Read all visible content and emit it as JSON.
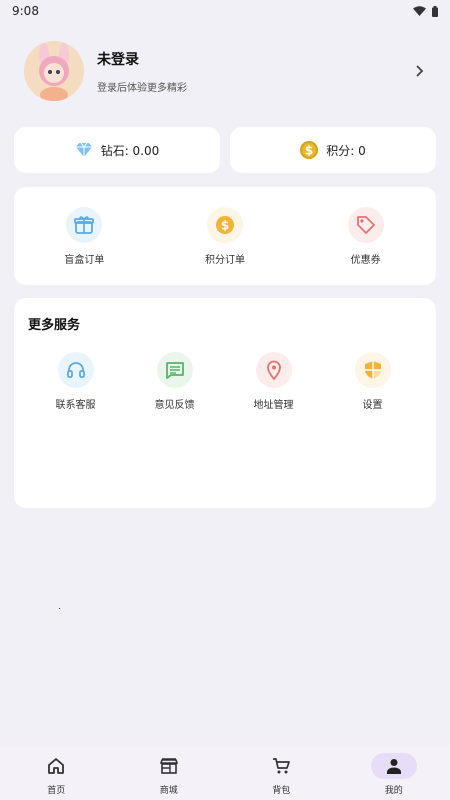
{
  "status_bar": {
    "time": "9:08"
  },
  "profile": {
    "name": "未登录",
    "subtitle": "登录后体验更多精彩"
  },
  "balances": {
    "diamond_label": "钻石: 0.00",
    "points_label": "积分: 0"
  },
  "orders": {
    "items": [
      {
        "label": "盲盒订单",
        "icon": "gift-box-icon",
        "color": "#5aa9e6"
      },
      {
        "label": "积分订单",
        "icon": "coin-icon",
        "color": "#f5b335"
      },
      {
        "label": "优惠券",
        "icon": "tag-icon",
        "color": "#e57373"
      }
    ]
  },
  "services": {
    "title": "更多服务",
    "items": [
      {
        "label": "联系客服",
        "icon": "headset-icon",
        "color": "#5aa9e6"
      },
      {
        "label": "意见反馈",
        "icon": "feedback-icon",
        "color": "#58b368"
      },
      {
        "label": "地址管理",
        "icon": "location-pin-icon",
        "color": "#e57373"
      },
      {
        "label": "设置",
        "icon": "shield-icon",
        "color": "#f5b335"
      }
    ]
  },
  "bottom_nav": {
    "items": [
      {
        "label": "首页",
        "icon": "home-icon"
      },
      {
        "label": "商城",
        "icon": "store-icon"
      },
      {
        "label": "背包",
        "icon": "cart-icon"
      },
      {
        "label": "我的",
        "icon": "person-icon",
        "active": true
      }
    ]
  }
}
